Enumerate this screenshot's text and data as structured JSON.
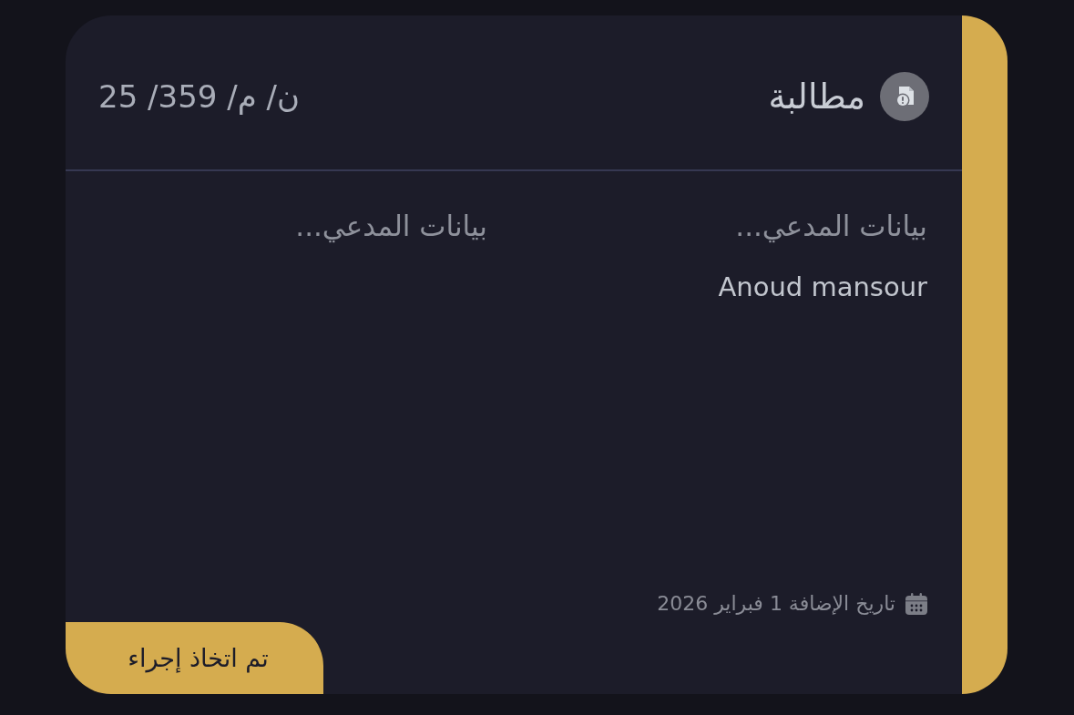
{
  "card": {
    "type": {
      "label": "مطالبة"
    },
    "reference": "ن/ م/ 359/ 25",
    "fields": [
      {
        "label": "بيانات المدعي...",
        "value": "Anoud mansour"
      },
      {
        "label": "بيانات المدعي..."
      }
    ],
    "date": "تاريخ الإضافة 1 فبراير 2026",
    "status": {
      "kind": "action_taken",
      "label": "تم اتخاذ إجراء"
    }
  }
}
